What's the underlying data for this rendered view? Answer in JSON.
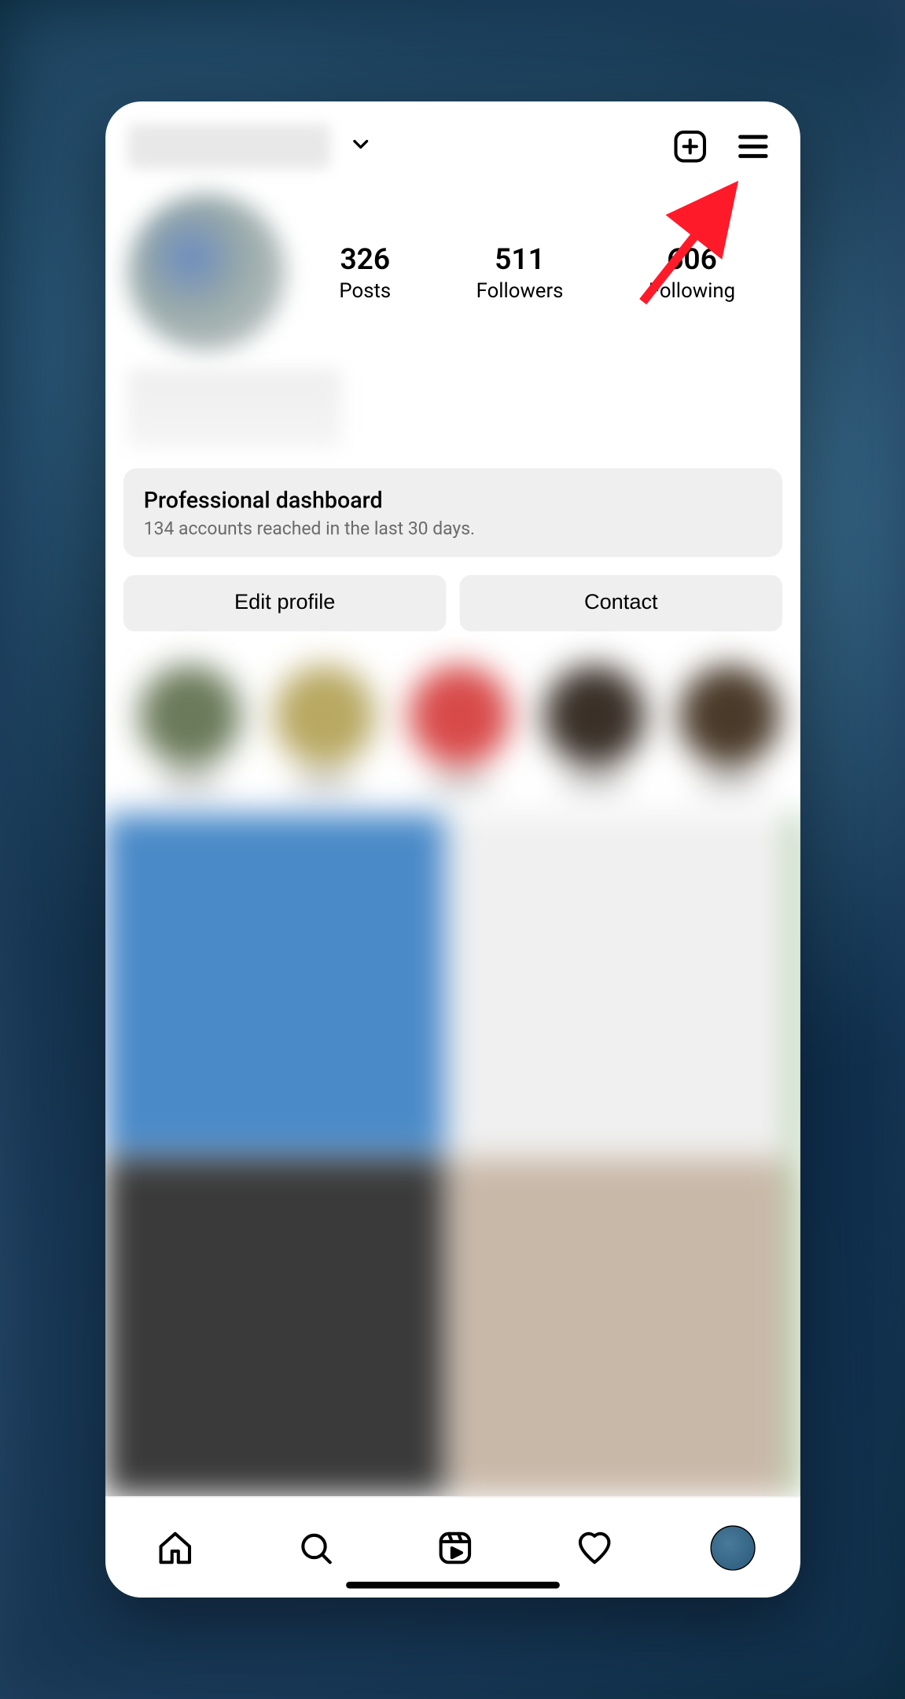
{
  "header": {
    "username_blurred": true
  },
  "stats": {
    "posts": {
      "count": "326",
      "label": "Posts"
    },
    "followers": {
      "count": "511",
      "label": "Followers"
    },
    "following": {
      "count": "606",
      "label": "Following"
    }
  },
  "dashboard": {
    "title": "Professional dashboard",
    "subtitle": "134 accounts reached in the last 30 days."
  },
  "actions": {
    "edit": "Edit profile",
    "contact": "Contact"
  },
  "highlights_colors": [
    "#6a7a5a",
    "#b8a862",
    "#d84a4a",
    "#3a3028",
    "#4a3a2a"
  ],
  "grid_colors": [
    "#4a8ac8",
    "#f0f0f0",
    "#5a9a4a",
    "#3a3a3a",
    "#c8b8a8",
    "#6aaa5a"
  ]
}
